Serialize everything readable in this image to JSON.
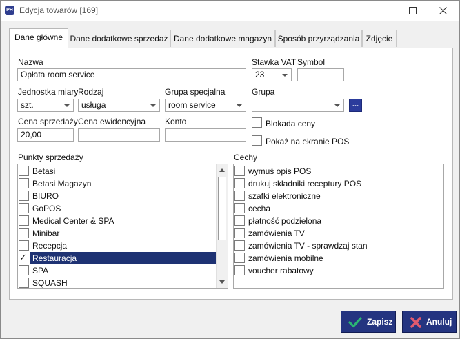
{
  "window": {
    "title": "Edycja towarów [169]",
    "app_icon_text": "PH"
  },
  "tabs": [
    {
      "label": "Dane główne"
    },
    {
      "label": "Dane dodatkowe sprzedaż"
    },
    {
      "label": "Dane dodatkowe magazyn"
    },
    {
      "label": "Sposób przyrządzania"
    },
    {
      "label": "Zdjęcie"
    }
  ],
  "form": {
    "nazwa_label": "Nazwa",
    "nazwa_value": "Opłata room service",
    "stawka_vat_label": "Stawka VAT",
    "stawka_vat_value": "23",
    "symbol_label": "Symbol",
    "symbol_value": "",
    "jednostka_label": "Jednostka miary",
    "jednostka_value": "szt.",
    "rodzaj_label": "Rodzaj",
    "rodzaj_value": "usługa",
    "grupa_specjalna_label": "Grupa specjalna",
    "grupa_specjalna_value": "room service",
    "grupa_label": "Grupa",
    "grupa_value": "",
    "grupa_button": "...",
    "cena_sprzedazy_label": "Cena sprzedaży",
    "cena_sprzedazy_value": "20,00",
    "cena_ewidencyjna_label": "Cena ewidencyjna",
    "cena_ewidencyjna_value": "",
    "konto_label": "Konto",
    "konto_value": "",
    "blokada_ceny_label": "Blokada ceny",
    "pokaz_pos_label": "Pokaż na ekranie POS"
  },
  "punkty_sprzedazy": {
    "label": "Punkty sprzedaży",
    "items": [
      {
        "label": "Betasi",
        "checked": false
      },
      {
        "label": "Betasi Magazyn",
        "checked": false
      },
      {
        "label": "BIURO",
        "checked": false
      },
      {
        "label": "GoPOS",
        "checked": false
      },
      {
        "label": "Medical Center & SPA",
        "checked": false
      },
      {
        "label": "Minibar",
        "checked": false
      },
      {
        "label": "Recepcja",
        "checked": false
      },
      {
        "label": "Restauracja",
        "checked": true
      },
      {
        "label": "SPA",
        "checked": false
      },
      {
        "label": "SQUASH",
        "checked": false
      }
    ],
    "check_mark": "✓"
  },
  "cechy": {
    "label": "Cechy",
    "items": [
      {
        "label": "wymuś opis POS"
      },
      {
        "label": "drukuj składniki receptury POS"
      },
      {
        "label": "szafki elektroniczne"
      },
      {
        "label": "cecha"
      },
      {
        "label": "płatność podzielona"
      },
      {
        "label": "zamówienia TV"
      },
      {
        "label": "zamówienia TV - sprawdzaj stan"
      },
      {
        "label": "zamówienia mobilne"
      },
      {
        "label": "voucher rabatowy"
      }
    ]
  },
  "buttons": {
    "save_label": "Zapisz",
    "cancel_label": "Anuluj"
  },
  "colors": {
    "accent": "#243480",
    "selection": "#1e3273",
    "save_icon": "#2bb673",
    "cancel_icon": "#e05a6e"
  }
}
